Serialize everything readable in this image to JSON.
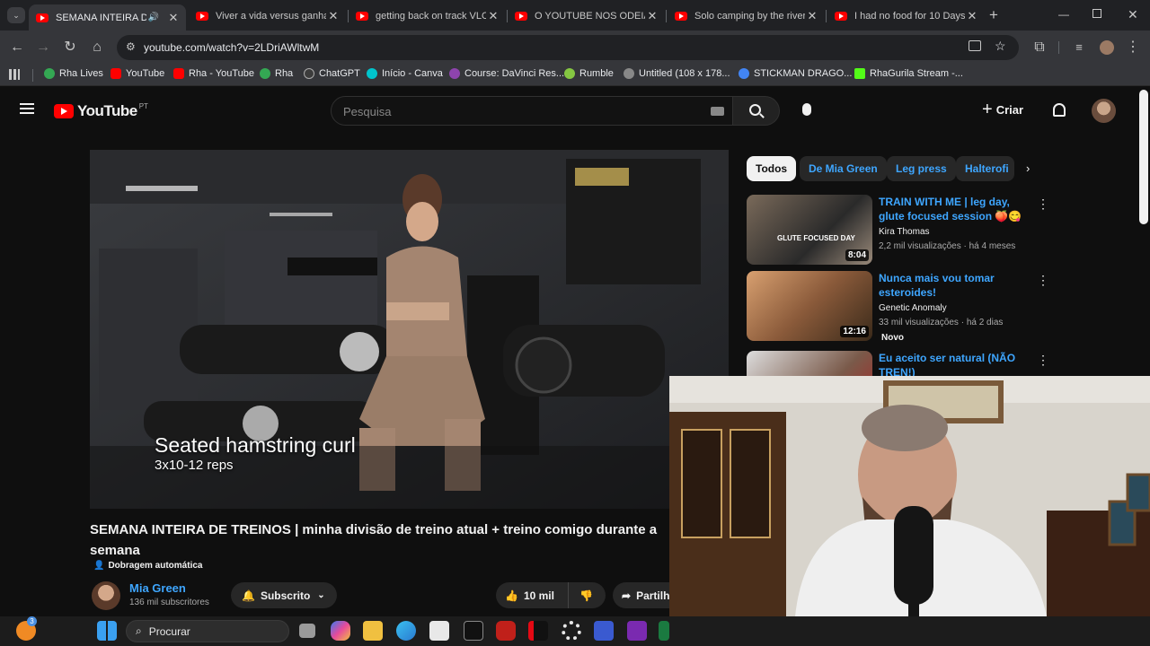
{
  "browser": {
    "tabs": [
      {
        "title": "SEMANA INTEIRA DE T",
        "active": true
      },
      {
        "title": "Viver a vida versus ganhar"
      },
      {
        "title": "getting back on track VLOG"
      },
      {
        "title": "O YOUTUBE NOS ODEIA -"
      },
      {
        "title": "Solo camping by the river"
      },
      {
        "title": "I had no food for 10 Days"
      }
    ],
    "url": "youtube.com/watch?v=2LDriAWltwM",
    "bookmarks": [
      {
        "label": "Rha Lives",
        "color": "#34a853"
      },
      {
        "label": "YouTube",
        "color": "#ff0000"
      },
      {
        "label": "Rha - YouTube",
        "color": "#ff0000"
      },
      {
        "label": "Rha",
        "color": "#34a853"
      },
      {
        "label": "ChatGPT",
        "color": "#3c3c3c"
      },
      {
        "label": "Início - Canva",
        "color": "#00c4cc"
      },
      {
        "label": "Course: DaVinci Res...",
        "color": "#8e44ad"
      },
      {
        "label": "Rumble",
        "color": "#85c742"
      },
      {
        "label": "Untitled (108 x 178...",
        "color": "#888888"
      },
      {
        "label": "STICKMAN DRAGO...",
        "color": "#4285f4"
      },
      {
        "label": "RhaGurila Stream -...",
        "color": "#53fc18"
      }
    ]
  },
  "youtube": {
    "logo_text": "YouTube",
    "region": "PT",
    "search_placeholder": "Pesquisa",
    "create_label": "Criar",
    "chips": [
      "Todos",
      "De Mia Green",
      "Leg press",
      "Halterofi"
    ],
    "recommendations": [
      {
        "title": "TRAIN WITH ME | leg day, glute focused session 🍑😋",
        "channel": "Kira Thomas",
        "meta": "2,2 mil visualizações · há 4 meses",
        "duration": "8:04",
        "thumb_text": "GLUTE FOCUSED DAY"
      },
      {
        "title": "Nunca mais vou tomar esteroides!",
        "channel": "Genetic Anomaly",
        "meta": "33 mil visualizações · há 2 dias",
        "badge": "Novo",
        "duration": "12:16"
      },
      {
        "title": "Eu aceito ser natural (NÃO TREN!)"
      }
    ],
    "video": {
      "overlay_title": "Seated hamstring curl",
      "overlay_sub": "3x10-12 reps",
      "title": "SEMANA INTEIRA DE TREINOS | minha divisão de treino atual + treino comigo durante a semana",
      "dubbing": "Dobragem automática",
      "channel": "Mia Green",
      "subscribers": "136 mil subscritores",
      "subscribe_label": "Subscrito",
      "likes": "10 mil",
      "share_label": "Partilhar"
    }
  },
  "taskbar": {
    "search_label": "Procurar",
    "notification_count": "3"
  },
  "colors": {
    "accent": "#3ea6ff",
    "brand": "#ff0000"
  }
}
